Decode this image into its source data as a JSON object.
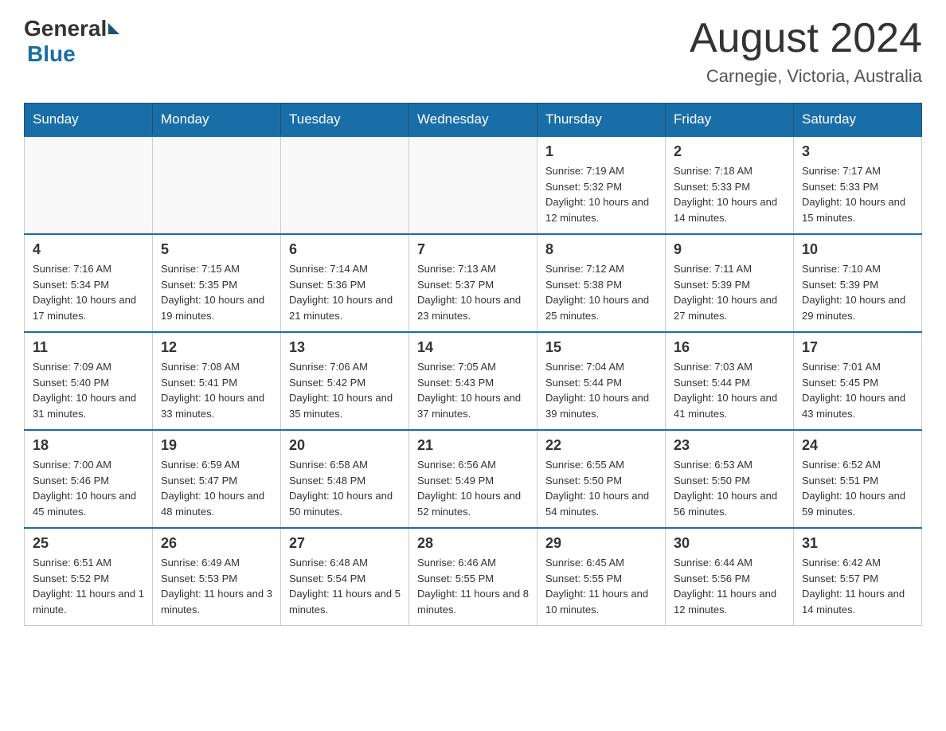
{
  "header": {
    "logo_general": "General",
    "logo_blue": "Blue",
    "month_year": "August 2024",
    "location": "Carnegie, Victoria, Australia"
  },
  "days_of_week": [
    "Sunday",
    "Monday",
    "Tuesday",
    "Wednesday",
    "Thursday",
    "Friday",
    "Saturday"
  ],
  "weeks": [
    {
      "days": [
        {
          "number": "",
          "info": ""
        },
        {
          "number": "",
          "info": ""
        },
        {
          "number": "",
          "info": ""
        },
        {
          "number": "",
          "info": ""
        },
        {
          "number": "1",
          "info": "Sunrise: 7:19 AM\nSunset: 5:32 PM\nDaylight: 10 hours and 12 minutes."
        },
        {
          "number": "2",
          "info": "Sunrise: 7:18 AM\nSunset: 5:33 PM\nDaylight: 10 hours and 14 minutes."
        },
        {
          "number": "3",
          "info": "Sunrise: 7:17 AM\nSunset: 5:33 PM\nDaylight: 10 hours and 15 minutes."
        }
      ]
    },
    {
      "days": [
        {
          "number": "4",
          "info": "Sunrise: 7:16 AM\nSunset: 5:34 PM\nDaylight: 10 hours and 17 minutes."
        },
        {
          "number": "5",
          "info": "Sunrise: 7:15 AM\nSunset: 5:35 PM\nDaylight: 10 hours and 19 minutes."
        },
        {
          "number": "6",
          "info": "Sunrise: 7:14 AM\nSunset: 5:36 PM\nDaylight: 10 hours and 21 minutes."
        },
        {
          "number": "7",
          "info": "Sunrise: 7:13 AM\nSunset: 5:37 PM\nDaylight: 10 hours and 23 minutes."
        },
        {
          "number": "8",
          "info": "Sunrise: 7:12 AM\nSunset: 5:38 PM\nDaylight: 10 hours and 25 minutes."
        },
        {
          "number": "9",
          "info": "Sunrise: 7:11 AM\nSunset: 5:39 PM\nDaylight: 10 hours and 27 minutes."
        },
        {
          "number": "10",
          "info": "Sunrise: 7:10 AM\nSunset: 5:39 PM\nDaylight: 10 hours and 29 minutes."
        }
      ]
    },
    {
      "days": [
        {
          "number": "11",
          "info": "Sunrise: 7:09 AM\nSunset: 5:40 PM\nDaylight: 10 hours and 31 minutes."
        },
        {
          "number": "12",
          "info": "Sunrise: 7:08 AM\nSunset: 5:41 PM\nDaylight: 10 hours and 33 minutes."
        },
        {
          "number": "13",
          "info": "Sunrise: 7:06 AM\nSunset: 5:42 PM\nDaylight: 10 hours and 35 minutes."
        },
        {
          "number": "14",
          "info": "Sunrise: 7:05 AM\nSunset: 5:43 PM\nDaylight: 10 hours and 37 minutes."
        },
        {
          "number": "15",
          "info": "Sunrise: 7:04 AM\nSunset: 5:44 PM\nDaylight: 10 hours and 39 minutes."
        },
        {
          "number": "16",
          "info": "Sunrise: 7:03 AM\nSunset: 5:44 PM\nDaylight: 10 hours and 41 minutes."
        },
        {
          "number": "17",
          "info": "Sunrise: 7:01 AM\nSunset: 5:45 PM\nDaylight: 10 hours and 43 minutes."
        }
      ]
    },
    {
      "days": [
        {
          "number": "18",
          "info": "Sunrise: 7:00 AM\nSunset: 5:46 PM\nDaylight: 10 hours and 45 minutes."
        },
        {
          "number": "19",
          "info": "Sunrise: 6:59 AM\nSunset: 5:47 PM\nDaylight: 10 hours and 48 minutes."
        },
        {
          "number": "20",
          "info": "Sunrise: 6:58 AM\nSunset: 5:48 PM\nDaylight: 10 hours and 50 minutes."
        },
        {
          "number": "21",
          "info": "Sunrise: 6:56 AM\nSunset: 5:49 PM\nDaylight: 10 hours and 52 minutes."
        },
        {
          "number": "22",
          "info": "Sunrise: 6:55 AM\nSunset: 5:50 PM\nDaylight: 10 hours and 54 minutes."
        },
        {
          "number": "23",
          "info": "Sunrise: 6:53 AM\nSunset: 5:50 PM\nDaylight: 10 hours and 56 minutes."
        },
        {
          "number": "24",
          "info": "Sunrise: 6:52 AM\nSunset: 5:51 PM\nDaylight: 10 hours and 59 minutes."
        }
      ]
    },
    {
      "days": [
        {
          "number": "25",
          "info": "Sunrise: 6:51 AM\nSunset: 5:52 PM\nDaylight: 11 hours and 1 minute."
        },
        {
          "number": "26",
          "info": "Sunrise: 6:49 AM\nSunset: 5:53 PM\nDaylight: 11 hours and 3 minutes."
        },
        {
          "number": "27",
          "info": "Sunrise: 6:48 AM\nSunset: 5:54 PM\nDaylight: 11 hours and 5 minutes."
        },
        {
          "number": "28",
          "info": "Sunrise: 6:46 AM\nSunset: 5:55 PM\nDaylight: 11 hours and 8 minutes."
        },
        {
          "number": "29",
          "info": "Sunrise: 6:45 AM\nSunset: 5:55 PM\nDaylight: 11 hours and 10 minutes."
        },
        {
          "number": "30",
          "info": "Sunrise: 6:44 AM\nSunset: 5:56 PM\nDaylight: 11 hours and 12 minutes."
        },
        {
          "number": "31",
          "info": "Sunrise: 6:42 AM\nSunset: 5:57 PM\nDaylight: 11 hours and 14 minutes."
        }
      ]
    }
  ]
}
